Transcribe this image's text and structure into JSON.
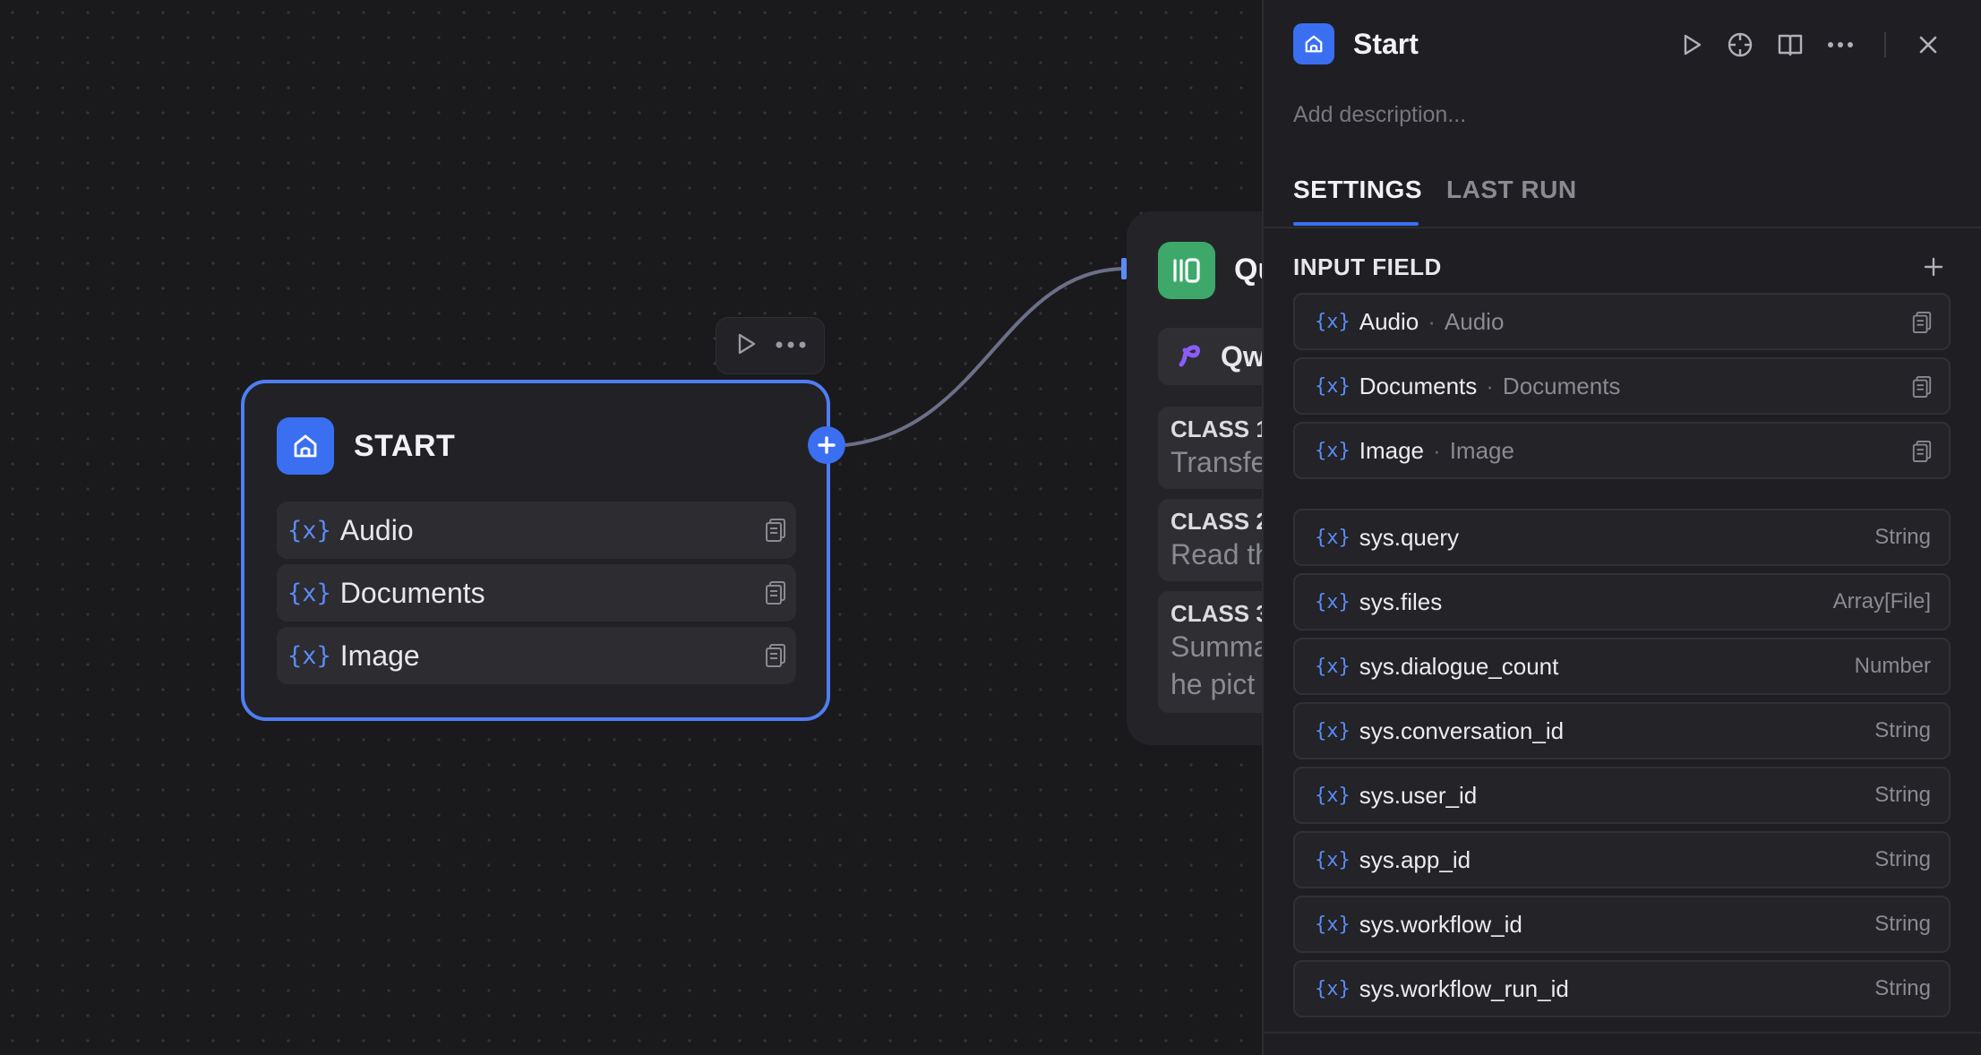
{
  "start_node": {
    "title": "START",
    "variables": [
      {
        "symbol": "{x}",
        "name": "Audio"
      },
      {
        "symbol": "{x}",
        "name": "Documents"
      },
      {
        "symbol": "{x}",
        "name": "Image"
      }
    ]
  },
  "classifier_node": {
    "title": "Qu",
    "model": "Qw",
    "classes": [
      {
        "label": "CLASS 1",
        "text_lines": [
          "Transfe"
        ]
      },
      {
        "label": "CLASS 2",
        "text_lines": [
          "Read th"
        ]
      },
      {
        "label": "CLASS 3",
        "text_lines": [
          "Summa",
          "he pict"
        ]
      }
    ]
  },
  "panel": {
    "title": "Start",
    "description_placeholder": "Add description...",
    "tabs": [
      {
        "label": "SETTINGS",
        "active": true
      },
      {
        "label": "LAST RUN",
        "active": false
      }
    ],
    "section_title": "INPUT FIELD",
    "input_fields": [
      {
        "symbol": "{x}",
        "name": "Audio",
        "label": "Audio"
      },
      {
        "symbol": "{x}",
        "name": "Documents",
        "label": "Documents"
      },
      {
        "symbol": "{x}",
        "name": "Image",
        "label": "Image"
      }
    ],
    "separator": "·",
    "system_vars": [
      {
        "symbol": "{x}",
        "name": "sys.query",
        "type": "String"
      },
      {
        "symbol": "{x}",
        "name": "sys.files",
        "type": "Array[File]"
      },
      {
        "symbol": "{x}",
        "name": "sys.dialogue_count",
        "type": "Number"
      },
      {
        "symbol": "{x}",
        "name": "sys.conversation_id",
        "type": "String"
      },
      {
        "symbol": "{x}",
        "name": "sys.user_id",
        "type": "String"
      },
      {
        "symbol": "{x}",
        "name": "sys.app_id",
        "type": "String"
      },
      {
        "symbol": "{x}",
        "name": "sys.workflow_id",
        "type": "String"
      },
      {
        "symbol": "{x}",
        "name": "sys.workflow_run_id",
        "type": "String"
      }
    ]
  },
  "colors": {
    "accent": "#3a6ff2",
    "node_border": "#4f7df4",
    "classifier_icon": "#3da86a",
    "model_icon": "#8b5cf6",
    "background": "#1a1a1d"
  },
  "icons": {
    "start_node": "home-icon",
    "classifier": "question-classifier-icon",
    "model": "model-logo-icon",
    "copy": "copy-icon",
    "run": "play-icon",
    "more": "more-dots-icon",
    "help": "crosshair-icon",
    "docs": "book-icon",
    "close": "close-icon",
    "add": "plus-icon"
  }
}
